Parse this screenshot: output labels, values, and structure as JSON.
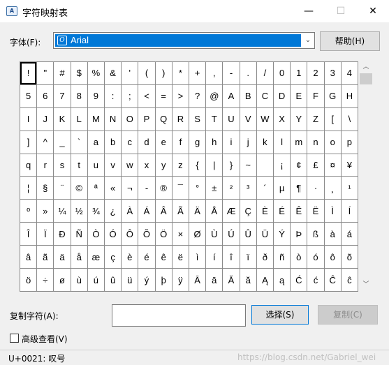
{
  "window": {
    "title": "字符映射表",
    "app_icon_glyph": "A",
    "minimize_glyph": "—",
    "maximize_glyph": "☐",
    "close_glyph": "✕"
  },
  "font": {
    "label": "字体(F):",
    "type_glyph": "O",
    "selected": "Arial",
    "dropdown_glyph": "⌄"
  },
  "help_button": "帮助(H)",
  "grid": {
    "selected_index": 0,
    "chars": [
      "!",
      "\"",
      "#",
      "$",
      "%",
      "&",
      "'",
      "(",
      ")",
      "*",
      "+",
      ",",
      "-",
      ".",
      "/",
      "0",
      "1",
      "2",
      "3",
      "4",
      "5",
      "6",
      "7",
      "8",
      "9",
      ":",
      ";",
      "<",
      "=",
      ">",
      "?",
      "@",
      "A",
      "B",
      "C",
      "D",
      "E",
      "F",
      "G",
      "H",
      "I",
      "J",
      "K",
      "L",
      "M",
      "N",
      "O",
      "P",
      "Q",
      "R",
      "S",
      "T",
      "U",
      "V",
      "W",
      "X",
      "Y",
      "Z",
      "[",
      "\\",
      "]",
      "^",
      "_",
      "`",
      "a",
      "b",
      "c",
      "d",
      "e",
      "f",
      "g",
      "h",
      "i",
      "j",
      "k",
      "l",
      "m",
      "n",
      "o",
      "p",
      "q",
      "r",
      "s",
      "t",
      "u",
      "v",
      "w",
      "x",
      "y",
      "z",
      "{",
      "|",
      "}",
      "~",
      " ",
      "¡",
      "¢",
      "£",
      "¤",
      "¥",
      "¦",
      "§",
      "¨",
      "©",
      "ª",
      "«",
      "¬",
      "-",
      "®",
      "¯",
      "°",
      "±",
      "²",
      "³",
      "´",
      "µ",
      "¶",
      "·",
      "¸",
      "¹",
      "º",
      "»",
      "¼",
      "½",
      "¾",
      "¿",
      "À",
      "Á",
      "Â",
      "Ã",
      "Ä",
      "Å",
      "Æ",
      "Ç",
      "È",
      "É",
      "Ê",
      "Ë",
      "Ì",
      "Í",
      "Î",
      "Ï",
      "Ð",
      "Ñ",
      "Ò",
      "Ó",
      "Ô",
      "Õ",
      "Ö",
      "×",
      "Ø",
      "Ù",
      "Ú",
      "Û",
      "Ü",
      "Ý",
      "Þ",
      "ß",
      "à",
      "á",
      "â",
      "ã",
      "ä",
      "å",
      "æ",
      "ç",
      "è",
      "é",
      "ê",
      "ë",
      "ì",
      "í",
      "î",
      "ï",
      "ð",
      "ñ",
      "ò",
      "ó",
      "ô",
      "õ",
      "ö",
      "÷",
      "ø",
      "ù",
      "ú",
      "û",
      "ü",
      "ý",
      "þ",
      "ÿ",
      "Ā",
      "ā",
      "Ă",
      "ă",
      "Ą",
      "ą",
      "Ć",
      "ć",
      "Ĉ",
      "ĉ"
    ]
  },
  "scrollbar": {
    "up_glyph": "︿",
    "down_glyph": "﹀"
  },
  "copy": {
    "label": "复制字符(A):",
    "value": "",
    "select_button": "选择(S)",
    "copy_button": "复制(C)"
  },
  "advanced": {
    "label": "高级查看(V)",
    "checked": false
  },
  "status": {
    "text": "U+0021: 叹号",
    "watermark": "https://blog.csdn.net/Gabriel_wei"
  }
}
